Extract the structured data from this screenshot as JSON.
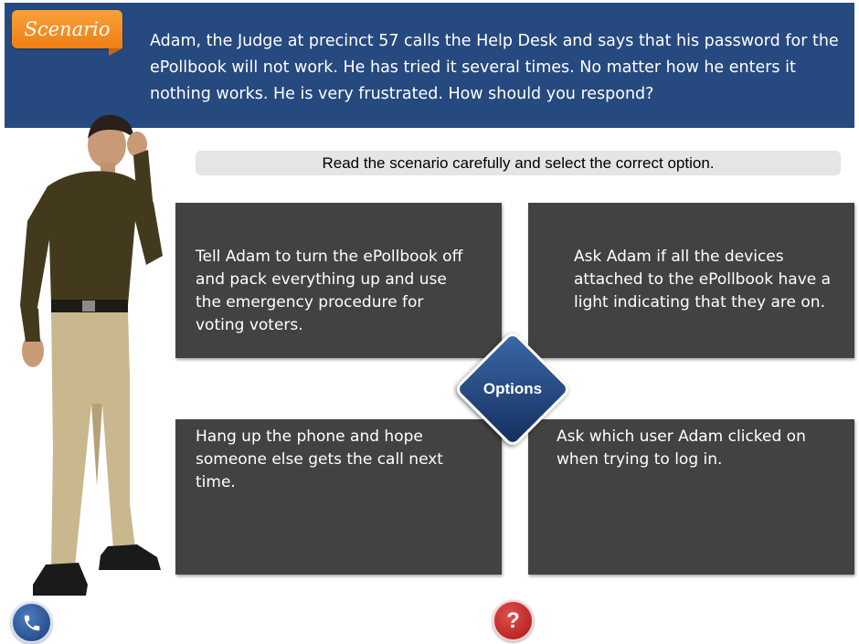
{
  "header": {
    "tag_label": "Scenario",
    "question": "Adam, the Judge at precinct 57 calls the Help Desk and says that his password for the ePollbook will not work. He has tried it several times. No matter how he enters it nothing works. He is very frustrated. How should you respond?"
  },
  "instruction": "Read the scenario carefully and select the correct option.",
  "center": {
    "label": "Options"
  },
  "options": [
    {
      "text": "Tell Adam to turn the ePollbook off and pack everything up and use the emergency procedure for voting voters."
    },
    {
      "text": "Ask Adam if all the devices attached to the ePollbook have a light indicating that they are on."
    },
    {
      "text": "Hang up the phone and hope someone else gets the call next time."
    },
    {
      "text": "Ask which user Adam clicked on when trying to log in."
    }
  ],
  "controls": {
    "phone_icon": "phone-icon",
    "help_label": "?"
  },
  "colors": {
    "header_bg": "#26497f",
    "tag_orange": "#f08a1e",
    "option_bg": "#424242",
    "diamond_blue": "#1f4788",
    "help_red": "#c62828"
  }
}
